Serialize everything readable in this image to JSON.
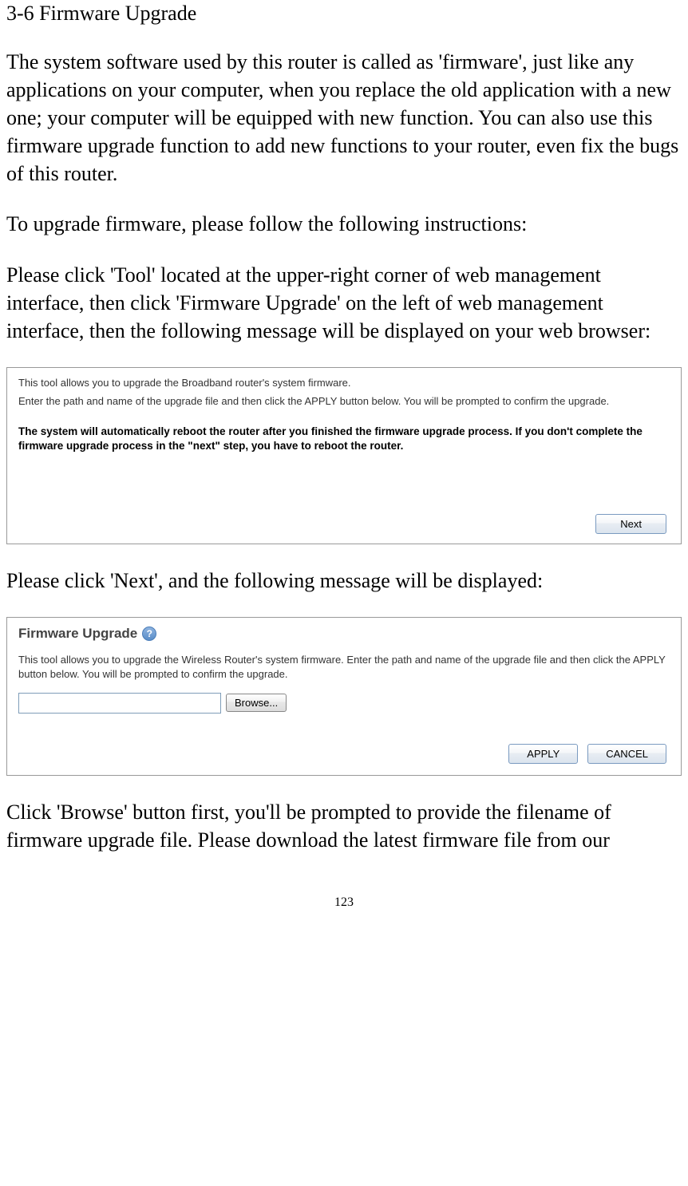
{
  "heading": "3-6 Firmware Upgrade",
  "para1": "The system software used by this router is called as 'firmware', just like any applications on your computer, when you replace the old application with a new one; your computer will be equipped with new function. You can also use this firmware upgrade function to add new functions to your router, even fix the bugs of this router.",
  "para2": "To upgrade firmware, please follow the following instructions:",
  "para3": "Please click 'Tool' located at the upper-right corner of web management interface, then click 'Firmware Upgrade' on the left of web management interface, then the following message will be displayed on your web browser:",
  "panel1": {
    "line1": "This tool allows you to upgrade the Broadband router's system firmware.",
    "line2": "Enter the path and name of the upgrade file and then click the APPLY button below. You will be prompted to confirm the upgrade.",
    "bold": "The system will automatically reboot the router after you finished the firmware upgrade process. If you don't complete the firmware upgrade process in the \"next\" step, you have to reboot the router.",
    "next_label": "Next"
  },
  "para4": "Please click 'Next', and the following message will be displayed:",
  "panel2": {
    "title": "Firmware Upgrade",
    "help": "?",
    "desc": "This tool allows you to upgrade the Wireless Router's system firmware. Enter the path and name of the upgrade file and then click the APPLY button below. You will be prompted to confirm the upgrade.",
    "file_value": "",
    "browse_label": "Browse...",
    "apply_label": "APPLY",
    "cancel_label": "CANCEL"
  },
  "para5": "Click 'Browse' button first, you'll be prompted to provide the filename of firmware upgrade file. Please download the latest firmware file from our",
  "page_number": "123"
}
